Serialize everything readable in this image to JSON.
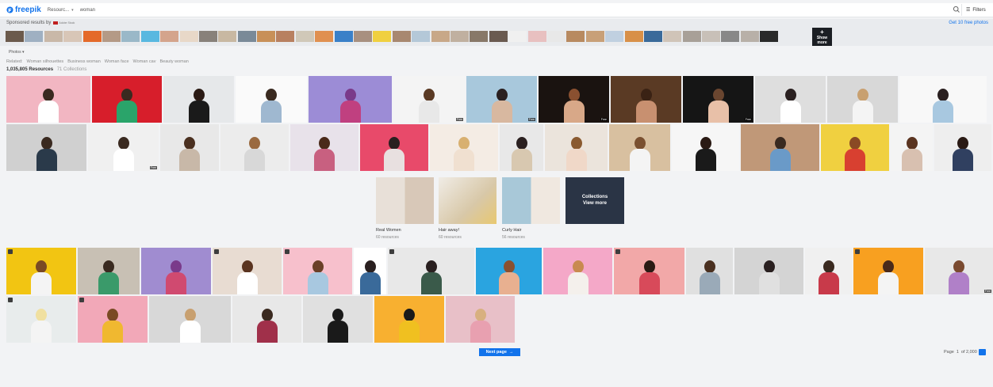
{
  "header": {
    "logo": "freepik",
    "resource_select": "Resourc...",
    "search_value": "woman",
    "filters_label": "Filters"
  },
  "sponsored": {
    "label": "Sponsored results by",
    "brand": "Adobe Stock",
    "free_link": "Get 10 free photos",
    "show_more": "Show more",
    "thumb_colors": [
      "#6b5a4c",
      "#9fb0c2",
      "#c9b8a8",
      "#d8c6b7",
      "#e46a2a",
      "#b49a86",
      "#9ab8c8",
      "#58b8e0",
      "#d4a48c",
      "#e8d8c8",
      "#88817a",
      "#c8b8a2",
      "#7a8a98",
      "#c89058",
      "#b88060",
      "#d0c8b8",
      "#e09050",
      "#3a80c8",
      "#a89080",
      "#f0d040",
      "#a88870",
      "#b4c8d8",
      "#c8a888",
      "#c0b0a0",
      "#887868",
      "#6a5a50",
      "#f0f0f0",
      "#e8c0c0",
      "#e8e8e8",
      "#b88a60",
      "#c8a078",
      "#c0d0e0",
      "#d89048",
      "#3a6a9a",
      "#d0c4b8",
      "#a8a098",
      "#c8c0b8",
      "#888888",
      "#b8b0a8",
      "#2a2a2a"
    ]
  },
  "filters_row": {
    "photos_chip": "Photos",
    "related_label": "Related:",
    "related": [
      "Woman silhouettes",
      "Business woman",
      "Woman face",
      "Woman cav",
      "Beauty woman"
    ],
    "count": "1,035,805 Resources",
    "collections": "71 Collections"
  },
  "badges": {
    "free": "Free"
  },
  "collections": [
    {
      "title": "Real Women",
      "sub": "60 resources"
    },
    {
      "title": "Hair away!",
      "sub": "60 resources"
    },
    {
      "title": "Curly Hair",
      "sub": "56 resources"
    }
  ],
  "collections_view": {
    "line1": "Collections",
    "line2": "View more"
  },
  "pager": {
    "next_label": "Next page",
    "page_label": "Page",
    "page": "1",
    "of": "of 2,000"
  }
}
